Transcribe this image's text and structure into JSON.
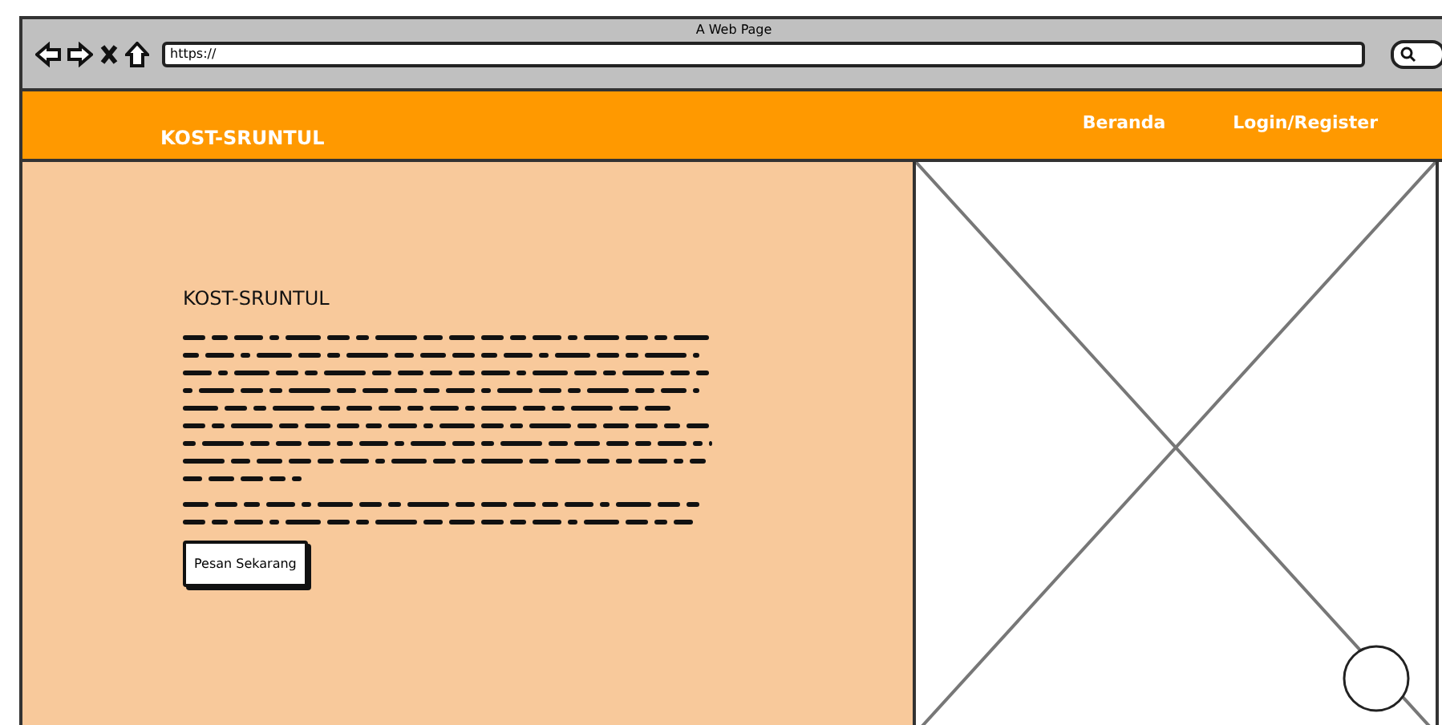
{
  "window": {
    "title": "A Web Page",
    "url": "https://"
  },
  "navbar": {
    "brand": "KOST-SRUNTUL",
    "links": [
      "Beranda",
      "Login/Register"
    ]
  },
  "hero": {
    "heading": "KOST-SRUNTUL",
    "button": "Pesan Sekarang"
  }
}
